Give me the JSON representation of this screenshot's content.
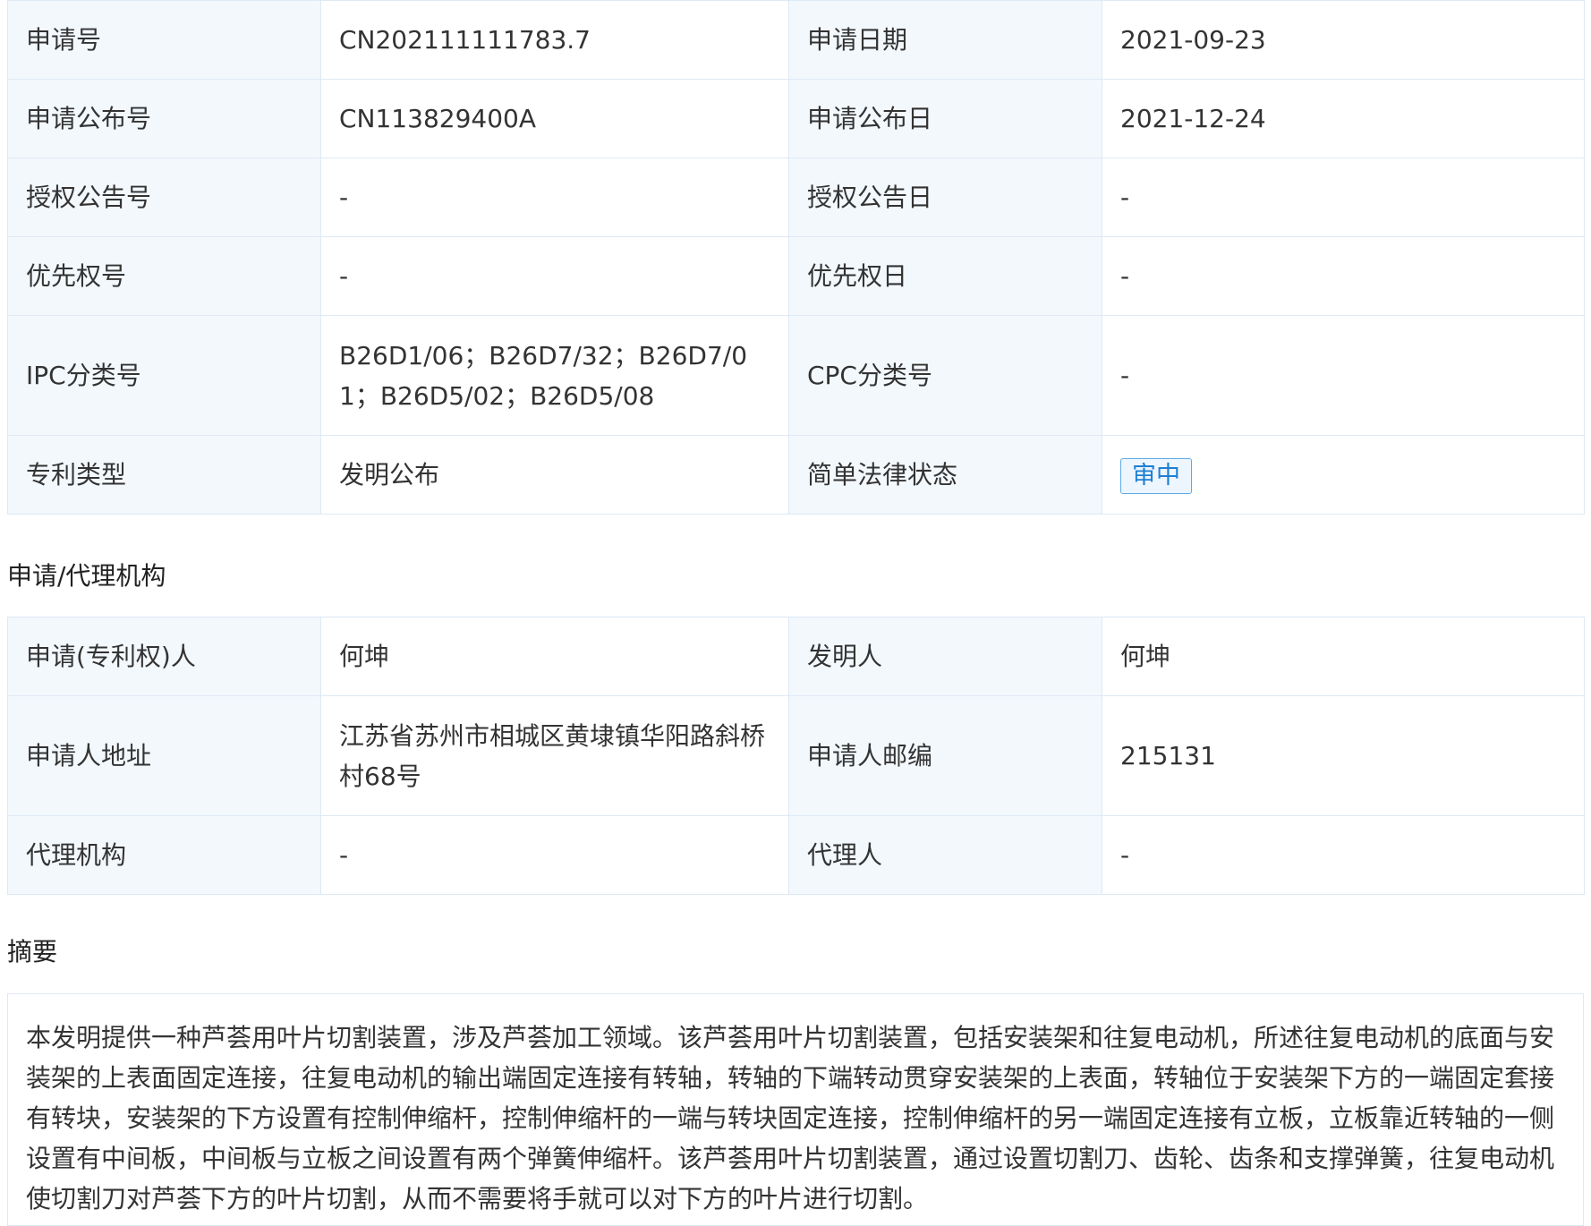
{
  "basic_info": {
    "rows": [
      {
        "l1": "申请号",
        "v1": "CN202111111783.7",
        "l2": "申请日期",
        "v2": "2021-09-23"
      },
      {
        "l1": "申请公布号",
        "v1": "CN113829400A",
        "l2": "申请公布日",
        "v2": "2021-12-24"
      },
      {
        "l1": "授权公告号",
        "v1": "-",
        "l2": "授权公告日",
        "v2": "-"
      },
      {
        "l1": "优先权号",
        "v1": "-",
        "l2": "优先权日",
        "v2": "-"
      },
      {
        "l1": "IPC分类号",
        "v1": "B26D1/06；B26D7/32；B26D7/01；B26D5/02；B26D5/08",
        "l2": "CPC分类号",
        "v2": "-"
      },
      {
        "l1": "专利类型",
        "v1": "发明公布",
        "l2": "简单法律状态",
        "v2": "审中"
      }
    ]
  },
  "agency": {
    "title": "申请/代理机构",
    "rows": [
      {
        "l1": "申请(专利权)人",
        "v1": "何坤",
        "l2": "发明人",
        "v2": "何坤"
      },
      {
        "l1": "申请人地址",
        "v1": "江苏省苏州市相城区黄埭镇华阳路斜桥村68号",
        "l2": "申请人邮编",
        "v2": "215131"
      },
      {
        "l1": "代理机构",
        "v1": "-",
        "l2": "代理人",
        "v2": "-"
      }
    ]
  },
  "abstract": {
    "title": "摘要",
    "text": "本发明提供一种芦荟用叶片切割装置，涉及芦荟加工领域。该芦荟用叶片切割装置，包括安装架和往复电动机，所述往复电动机的底面与安装架的上表面固定连接，往复电动机的输出端固定连接有转轴，转轴的下端转动贯穿安装架的上表面，转轴位于安装架下方的一端固定套接有转块，安装架的下方设置有控制伸缩杆，控制伸缩杆的一端与转块固定连接，控制伸缩杆的另一端固定连接有立板，立板靠近转轴的一侧设置有中间板，中间板与立板之间设置有两个弹簧伸缩杆。该芦荟用叶片切割装置，通过设置切割刀、齿轮、齿条和支撑弹簧，往复电动机使切割刀对芦荟下方的叶片切割，从而不需要将手就可以对下方的叶片进行切割。"
  },
  "colors": {
    "label_bg": "#f3f8fd",
    "border": "#dde9f5",
    "badge_text": "#1d7fd4",
    "badge_border": "#5fa9e6"
  }
}
